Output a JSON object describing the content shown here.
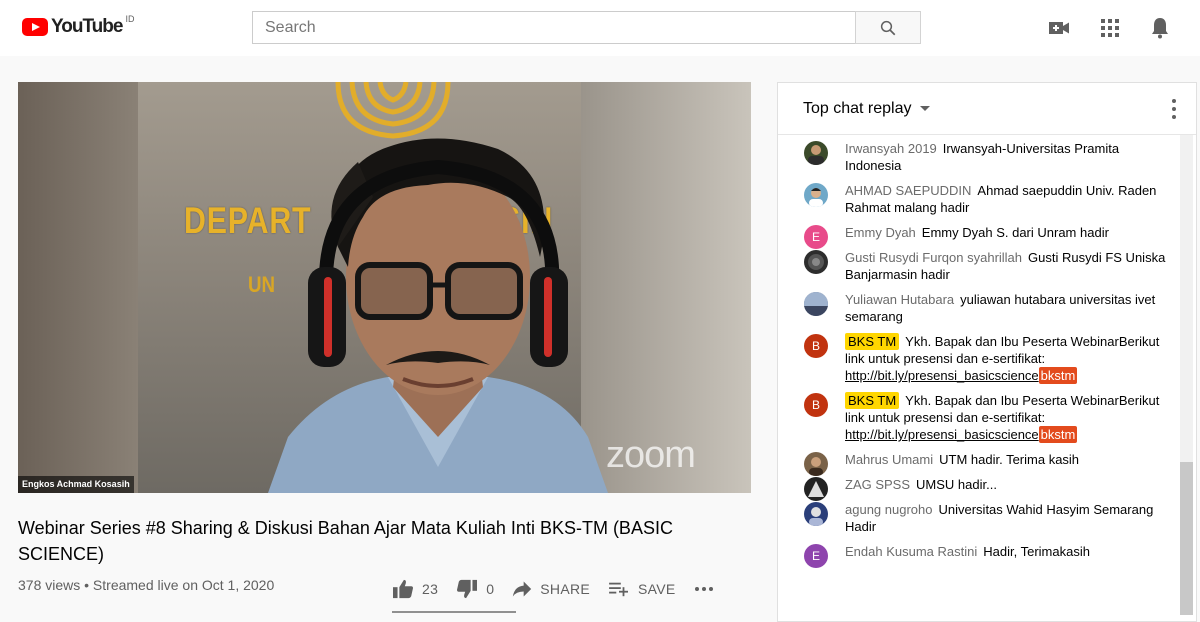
{
  "header": {
    "logo_text": "YouTube",
    "logo_country": "ID",
    "search_placeholder": "Search",
    "icons": [
      "video-create-icon",
      "apps-grid-icon",
      "notification-bell-icon"
    ]
  },
  "video": {
    "speaker_name": "Engkos Achmad Kosasih",
    "watermark": "zoom",
    "wall_text_line1": "DEPART",
    "wall_text_line1_right": "SIN",
    "wall_text_line2": "UN",
    "title": "Webinar Series #8 Sharing & Diskusi Bahan Ajar Mata Kuliah Inti BKS-TM (BASIC SCIENCE)",
    "views_date": "378 views • Streamed live on Oct 1, 2020",
    "likes": "23",
    "dislikes": "0",
    "share_label": "SHARE",
    "save_label": "SAVE"
  },
  "chat": {
    "title": "Top chat replay",
    "messages": [
      {
        "author": "Irwansyah 2019",
        "text": "Irwansyah-Universitas Pramita Indonesia",
        "avatar_color": "#3b4a2a"
      },
      {
        "author": "AHMAD SAEPUDDIN",
        "text": "Ahmad saepuddin Univ. Raden Rahmat malang hadir",
        "avatar_color": "#6fa8c8"
      },
      {
        "author": "Emmy Dyah",
        "text": "Emmy Dyah S. dari Unram hadir",
        "avatar_letter": "E",
        "avatar_color": "#e84b8a"
      },
      {
        "author": "Gusti Rusydi Furqon syahrillah",
        "text": "Gusti Rusydi FS Uniska Banjarmasin hadir",
        "avatar_color": "#2d2d2d"
      },
      {
        "author": "Yuliawan Hutabara",
        "text": "yuliawan hutabara universitas ivet semarang",
        "avatar_color": "#5a6a8a"
      },
      {
        "author": "BKS TM",
        "text": "Ykh. Bapak dan Ibu Peserta WebinarBerikut link untuk presensi dan e-sertifikat:",
        "link": "http://bit.ly/presensi_basicscience",
        "tag": "bkstm",
        "avatar_letter": "B",
        "avatar_color": "#c1330f"
      },
      {
        "author": "BKS TM",
        "text": "Ykh. Bapak dan Ibu Peserta WebinarBerikut link untuk presensi dan e-sertifikat:",
        "link": "http://bit.ly/presensi_basicscience",
        "tag": "bkstm",
        "avatar_letter": "B",
        "avatar_color": "#c1330f"
      },
      {
        "author": "Mahrus Umami",
        "text": "UTM hadir. Terima kasih",
        "avatar_color": "#7a6248"
      },
      {
        "author": "ZAG SPSS",
        "text": "UMSU hadir...",
        "avatar_color": "#222222"
      },
      {
        "author": "agung nugroho",
        "text": "Universitas Wahid Hasyim Semarang Hadir",
        "avatar_color": "#2b3f7a"
      },
      {
        "author": "Endah Kusuma Rastini",
        "text": "Hadir, Terimakasih",
        "avatar_letter": "E",
        "avatar_color": "#8e44ad"
      }
    ]
  }
}
